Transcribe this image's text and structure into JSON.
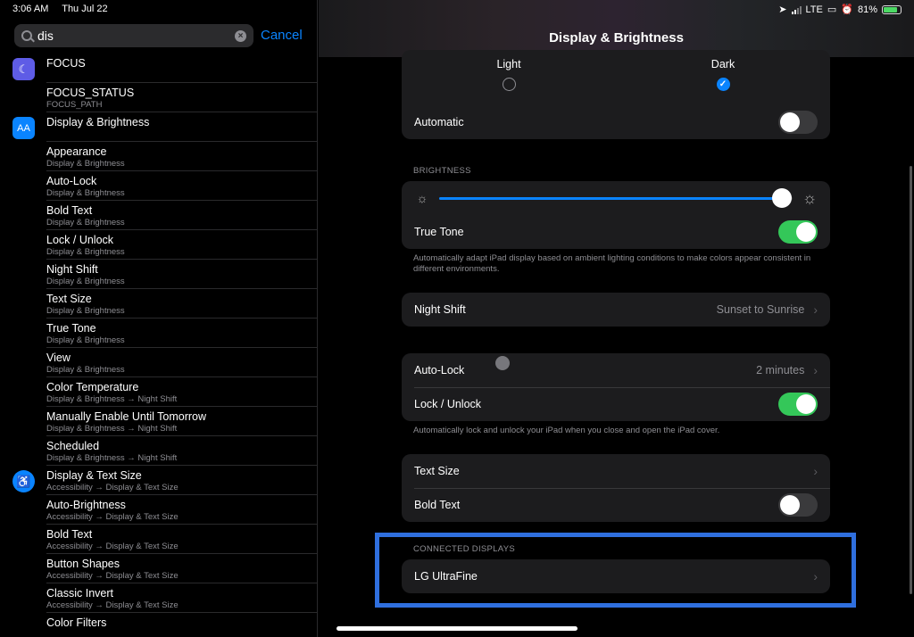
{
  "status": {
    "time": "3:06 AM",
    "date": "Thu Jul 22",
    "network": "LTE",
    "battery": "81%",
    "battery_level": 0.81
  },
  "search": {
    "value": "dis",
    "cancel_label": "Cancel"
  },
  "results": [
    {
      "title": "FOCUS",
      "subtitle": "",
      "icon": "moon-icon",
      "icon_color": "#5e5ce6"
    },
    {
      "title": "FOCUS_STATUS",
      "subtitle": "FOCUS_PATH"
    },
    {
      "title": "Display & Brightness",
      "subtitle": "",
      "icon": "text-size-icon",
      "icon_color": "#0a84ff"
    },
    {
      "title": "Appearance",
      "subtitle": "Display & Brightness"
    },
    {
      "title": "Auto-Lock",
      "subtitle": "Display & Brightness"
    },
    {
      "title": "Bold Text",
      "subtitle": "Display & Brightness"
    },
    {
      "title": "Lock / Unlock",
      "subtitle": "Display & Brightness"
    },
    {
      "title": "Night Shift",
      "subtitle": "Display & Brightness"
    },
    {
      "title": "Text Size",
      "subtitle": "Display & Brightness"
    },
    {
      "title": "True Tone",
      "subtitle": "Display & Brightness"
    },
    {
      "title": "View",
      "subtitle": "Display & Brightness"
    },
    {
      "title": "Color Temperature",
      "subtitle": "Display & Brightness → Night Shift"
    },
    {
      "title": "Manually Enable Until Tomorrow",
      "subtitle": "Display & Brightness → Night Shift"
    },
    {
      "title": "Scheduled",
      "subtitle": "Display & Brightness → Night Shift"
    },
    {
      "title": "Display & Text Size",
      "subtitle": "Accessibility → Display & Text Size",
      "icon": "accessibility-icon",
      "icon_color": "#0a84ff"
    },
    {
      "title": "Auto-Brightness",
      "subtitle": "Accessibility → Display & Text Size"
    },
    {
      "title": "Bold Text",
      "subtitle": "Accessibility → Display & Text Size"
    },
    {
      "title": "Button Shapes",
      "subtitle": "Accessibility → Display & Text Size"
    },
    {
      "title": "Classic Invert",
      "subtitle": "Accessibility → Display & Text Size"
    },
    {
      "title": "Color Filters",
      "subtitle": ""
    }
  ],
  "main": {
    "title": "Display & Brightness",
    "appearance": {
      "light_label": "Light",
      "dark_label": "Dark",
      "selected": "Dark",
      "automatic_label": "Automatic",
      "automatic_on": false
    },
    "brightness": {
      "header": "BRIGHTNESS",
      "level": 0.97,
      "true_tone_label": "True Tone",
      "true_tone_on": true,
      "footnote": "Automatically adapt iPad display based on ambient lighting conditions to make colors appear consistent in different environments."
    },
    "night_shift": {
      "label": "Night Shift",
      "value": "Sunset to Sunrise"
    },
    "lock": {
      "auto_lock_label": "Auto-Lock",
      "auto_lock_value": "2 minutes",
      "lock_unlock_label": "Lock / Unlock",
      "lock_unlock_on": true,
      "footnote": "Automatically lock and unlock your iPad when you close and open the iPad cover."
    },
    "text": {
      "text_size_label": "Text Size",
      "bold_text_label": "Bold Text",
      "bold_text_on": false
    },
    "connected": {
      "header": "CONNECTED DISPLAYS",
      "display_label": "LG UltraFine"
    }
  },
  "colors": {
    "accent": "#0a84ff",
    "toggle_on": "#34c759",
    "highlight": "#2f6fde"
  }
}
